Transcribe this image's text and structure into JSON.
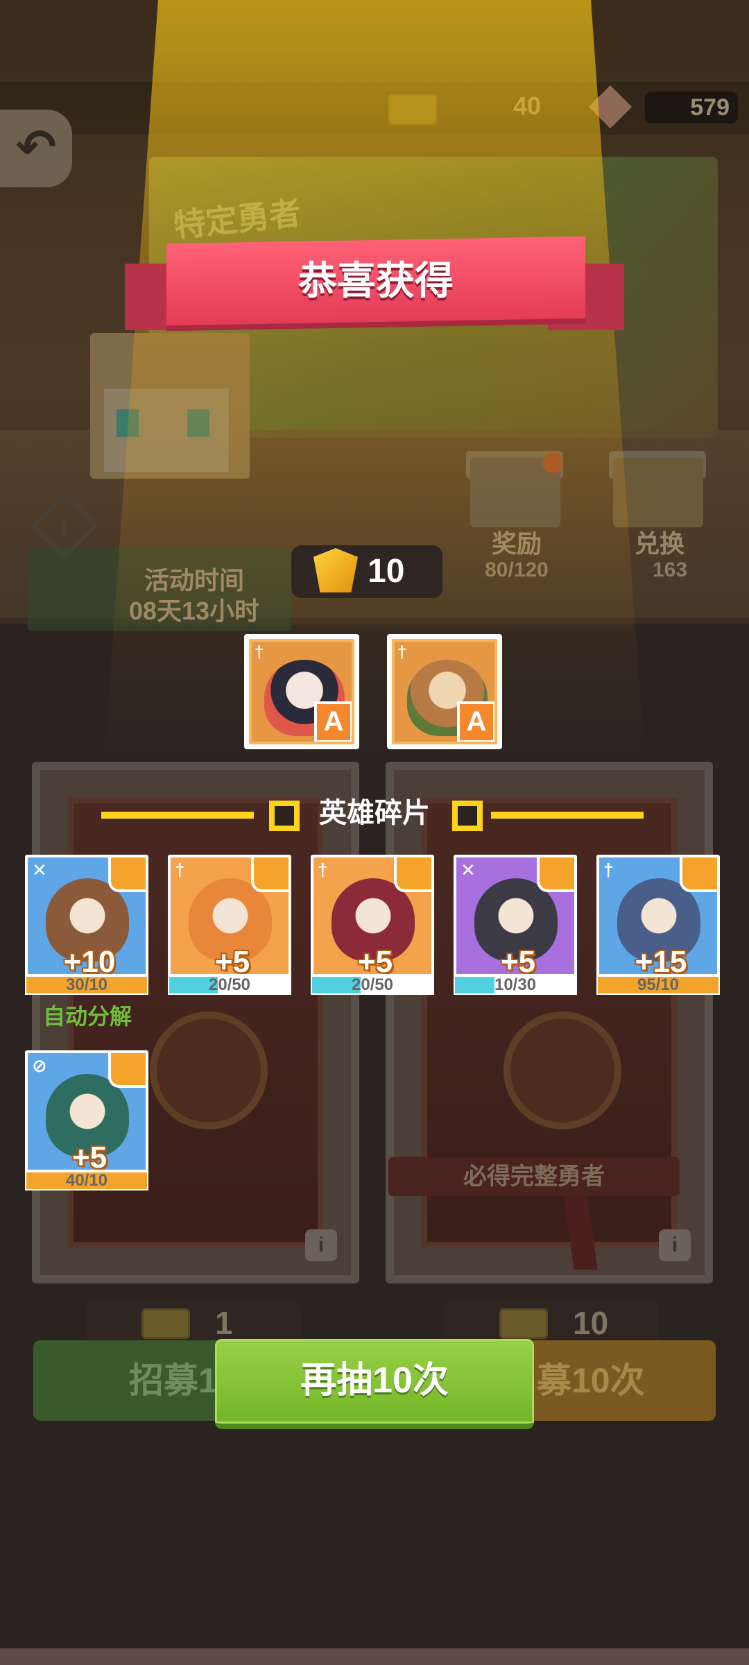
{
  "topbar": {
    "left_count": "40",
    "gems": "579"
  },
  "banner": {
    "art_title": "特定勇者"
  },
  "title": "恭喜获得",
  "event": {
    "time_label": "活动时间",
    "time_value": "08天13小时"
  },
  "side": {
    "reward_label": "奖励",
    "reward_progress": "80/120",
    "exchange_label": "兑换",
    "exchange_value": "163"
  },
  "gold_gain": "10",
  "heroes": [
    {
      "badge": "A",
      "portrait_color": "#e0574a",
      "icon": "sword"
    },
    {
      "badge": "A",
      "portrait_color": "#b77a45",
      "icon": "sword"
    }
  ],
  "fragments_title": "英雄碎片",
  "fragments": [
    {
      "amount": "+10",
      "progress": "30/10",
      "progress_fraction": 1.0,
      "bar_color": "#f3a52b",
      "frame_color": "#5ea6e6",
      "portrait_color": "#8a5a3a",
      "class_icon": "hammer"
    },
    {
      "amount": "+5",
      "progress": "20/50",
      "progress_fraction": 0.4,
      "bar_color": "#4fd1e0",
      "frame_color": "#f4a24b",
      "portrait_color": "#e8873a",
      "class_icon": "sword"
    },
    {
      "amount": "+5",
      "progress": "20/50",
      "progress_fraction": 0.4,
      "bar_color": "#4fd1e0",
      "frame_color": "#f4a24b",
      "portrait_color": "#8c2a3a",
      "class_icon": "sword"
    },
    {
      "amount": "+5",
      "progress": "10/30",
      "progress_fraction": 0.33,
      "bar_color": "#4fd1e0",
      "frame_color": "#a86fdf",
      "portrait_color": "#3c3a44",
      "class_icon": "hammer"
    },
    {
      "amount": "+15",
      "progress": "95/10",
      "progress_fraction": 1.0,
      "bar_color": "#f3a52b",
      "frame_color": "#5ea6e6",
      "portrait_color": "#4a5e8a",
      "class_icon": "sword"
    },
    {
      "amount": "+5",
      "progress": "40/10",
      "progress_fraction": 1.0,
      "bar_color": "#f3a52b",
      "frame_color": "#5ea6e6",
      "portrait_color": "#2f6d60",
      "class_icon": "compass"
    }
  ],
  "auto_decompose": "自动分解",
  "guarantee": "必得完整勇者",
  "costs": {
    "single": "1",
    "ten": "10"
  },
  "buttons": {
    "recruit_once": "招募1",
    "recruit_ten": "募10次",
    "redraw": "再抽10次"
  }
}
